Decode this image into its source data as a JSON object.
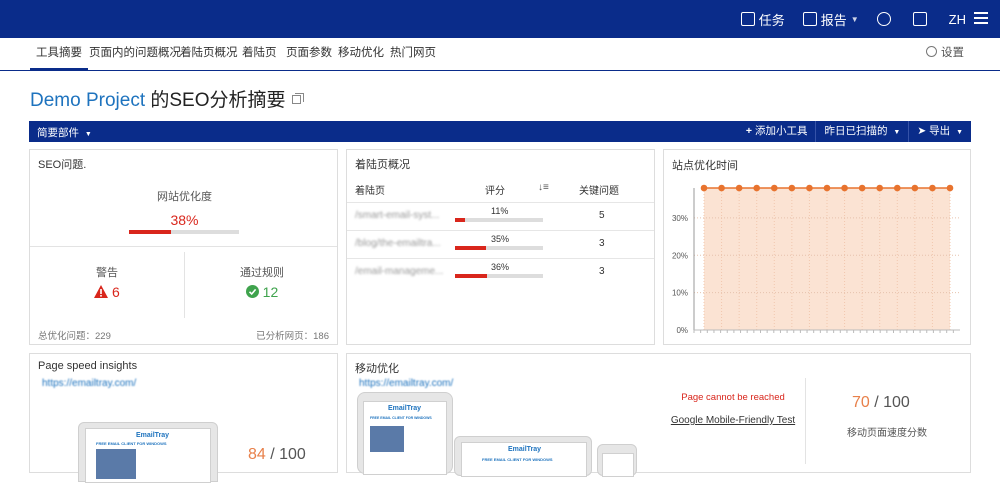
{
  "topnav": {
    "tasks": "任务",
    "report": "报告",
    "lang": "ZH"
  },
  "tabs": [
    "工具摘要",
    "页面内的问题概况",
    "着陆页概况",
    "着陆页",
    "页面参数",
    "移动优化",
    "热门网页"
  ],
  "settings_label": "设置",
  "page": {
    "project": "Demo Project",
    "title_suffix": " 的SEO分析摘要"
  },
  "widget_bar": {
    "summary": "简要部件",
    "add_widget": "添加小工具",
    "scanned": "昨日已扫描的",
    "export": "导出"
  },
  "seo": {
    "title": "SEO问题.",
    "health_label": "网站优化度",
    "health_value": "38%",
    "health_fraction": 0.38,
    "warnings_label": "警告",
    "warnings_value": "6",
    "passed_label": "通过规则",
    "passed_value": "12",
    "footer_left": "总优化问题：229",
    "footer_right": "已分析网页：186"
  },
  "landing": {
    "title": "着陆页概况",
    "col_page": "着陆页",
    "col_score": "评分",
    "col_issues": "关键问题",
    "rows": [
      {
        "page": "/smart-email-syst...",
        "score": "11%",
        "fraction": 0.11,
        "issues": "5"
      },
      {
        "page": "/blog/the-emailtra...",
        "score": "35%",
        "fraction": 0.35,
        "issues": "3"
      },
      {
        "page": "/email-manageme...",
        "score": "36%",
        "fraction": 0.36,
        "issues": "3"
      }
    ]
  },
  "site_time": {
    "title": "站点优化时间"
  },
  "chart_data": {
    "type": "area",
    "title": "站点优化时间",
    "xlabel": "",
    "ylabel": "",
    "yticks": [
      "0%",
      "10%",
      "20%",
      "30%"
    ],
    "ylim": [
      0,
      38
    ],
    "x": [
      1,
      2,
      3,
      4,
      5,
      6,
      7,
      8,
      9,
      10,
      11,
      12,
      13,
      14,
      15
    ],
    "values": [
      38,
      38,
      38,
      38,
      38,
      38,
      38,
      38,
      38,
      38,
      38,
      38,
      38,
      38,
      38
    ],
    "colors": {
      "line": "#e8732e",
      "fill": "#fbe3d3"
    }
  },
  "speed": {
    "title": "Page speed insights",
    "url": "https://emailtray.com/",
    "score_value": "84",
    "score_max": " / 100"
  },
  "mobile": {
    "title": "移动优化",
    "url": "https://emailtray.com/",
    "unreachable": "Page cannot be reached",
    "test_link": "Google Mobile-Friendly Test",
    "score_value": "70",
    "score_max": " / 100",
    "score_label": "移动页面速度分数",
    "logo_text": "EmailTray",
    "screen_heading": "FREE EMAIL CLIENT FOR WINDOWS"
  },
  "colors": {
    "brand": "#0a2c8a",
    "link": "#1e73be",
    "danger": "#d9261c",
    "success": "#3fa34d",
    "accent": "#e8804a"
  }
}
